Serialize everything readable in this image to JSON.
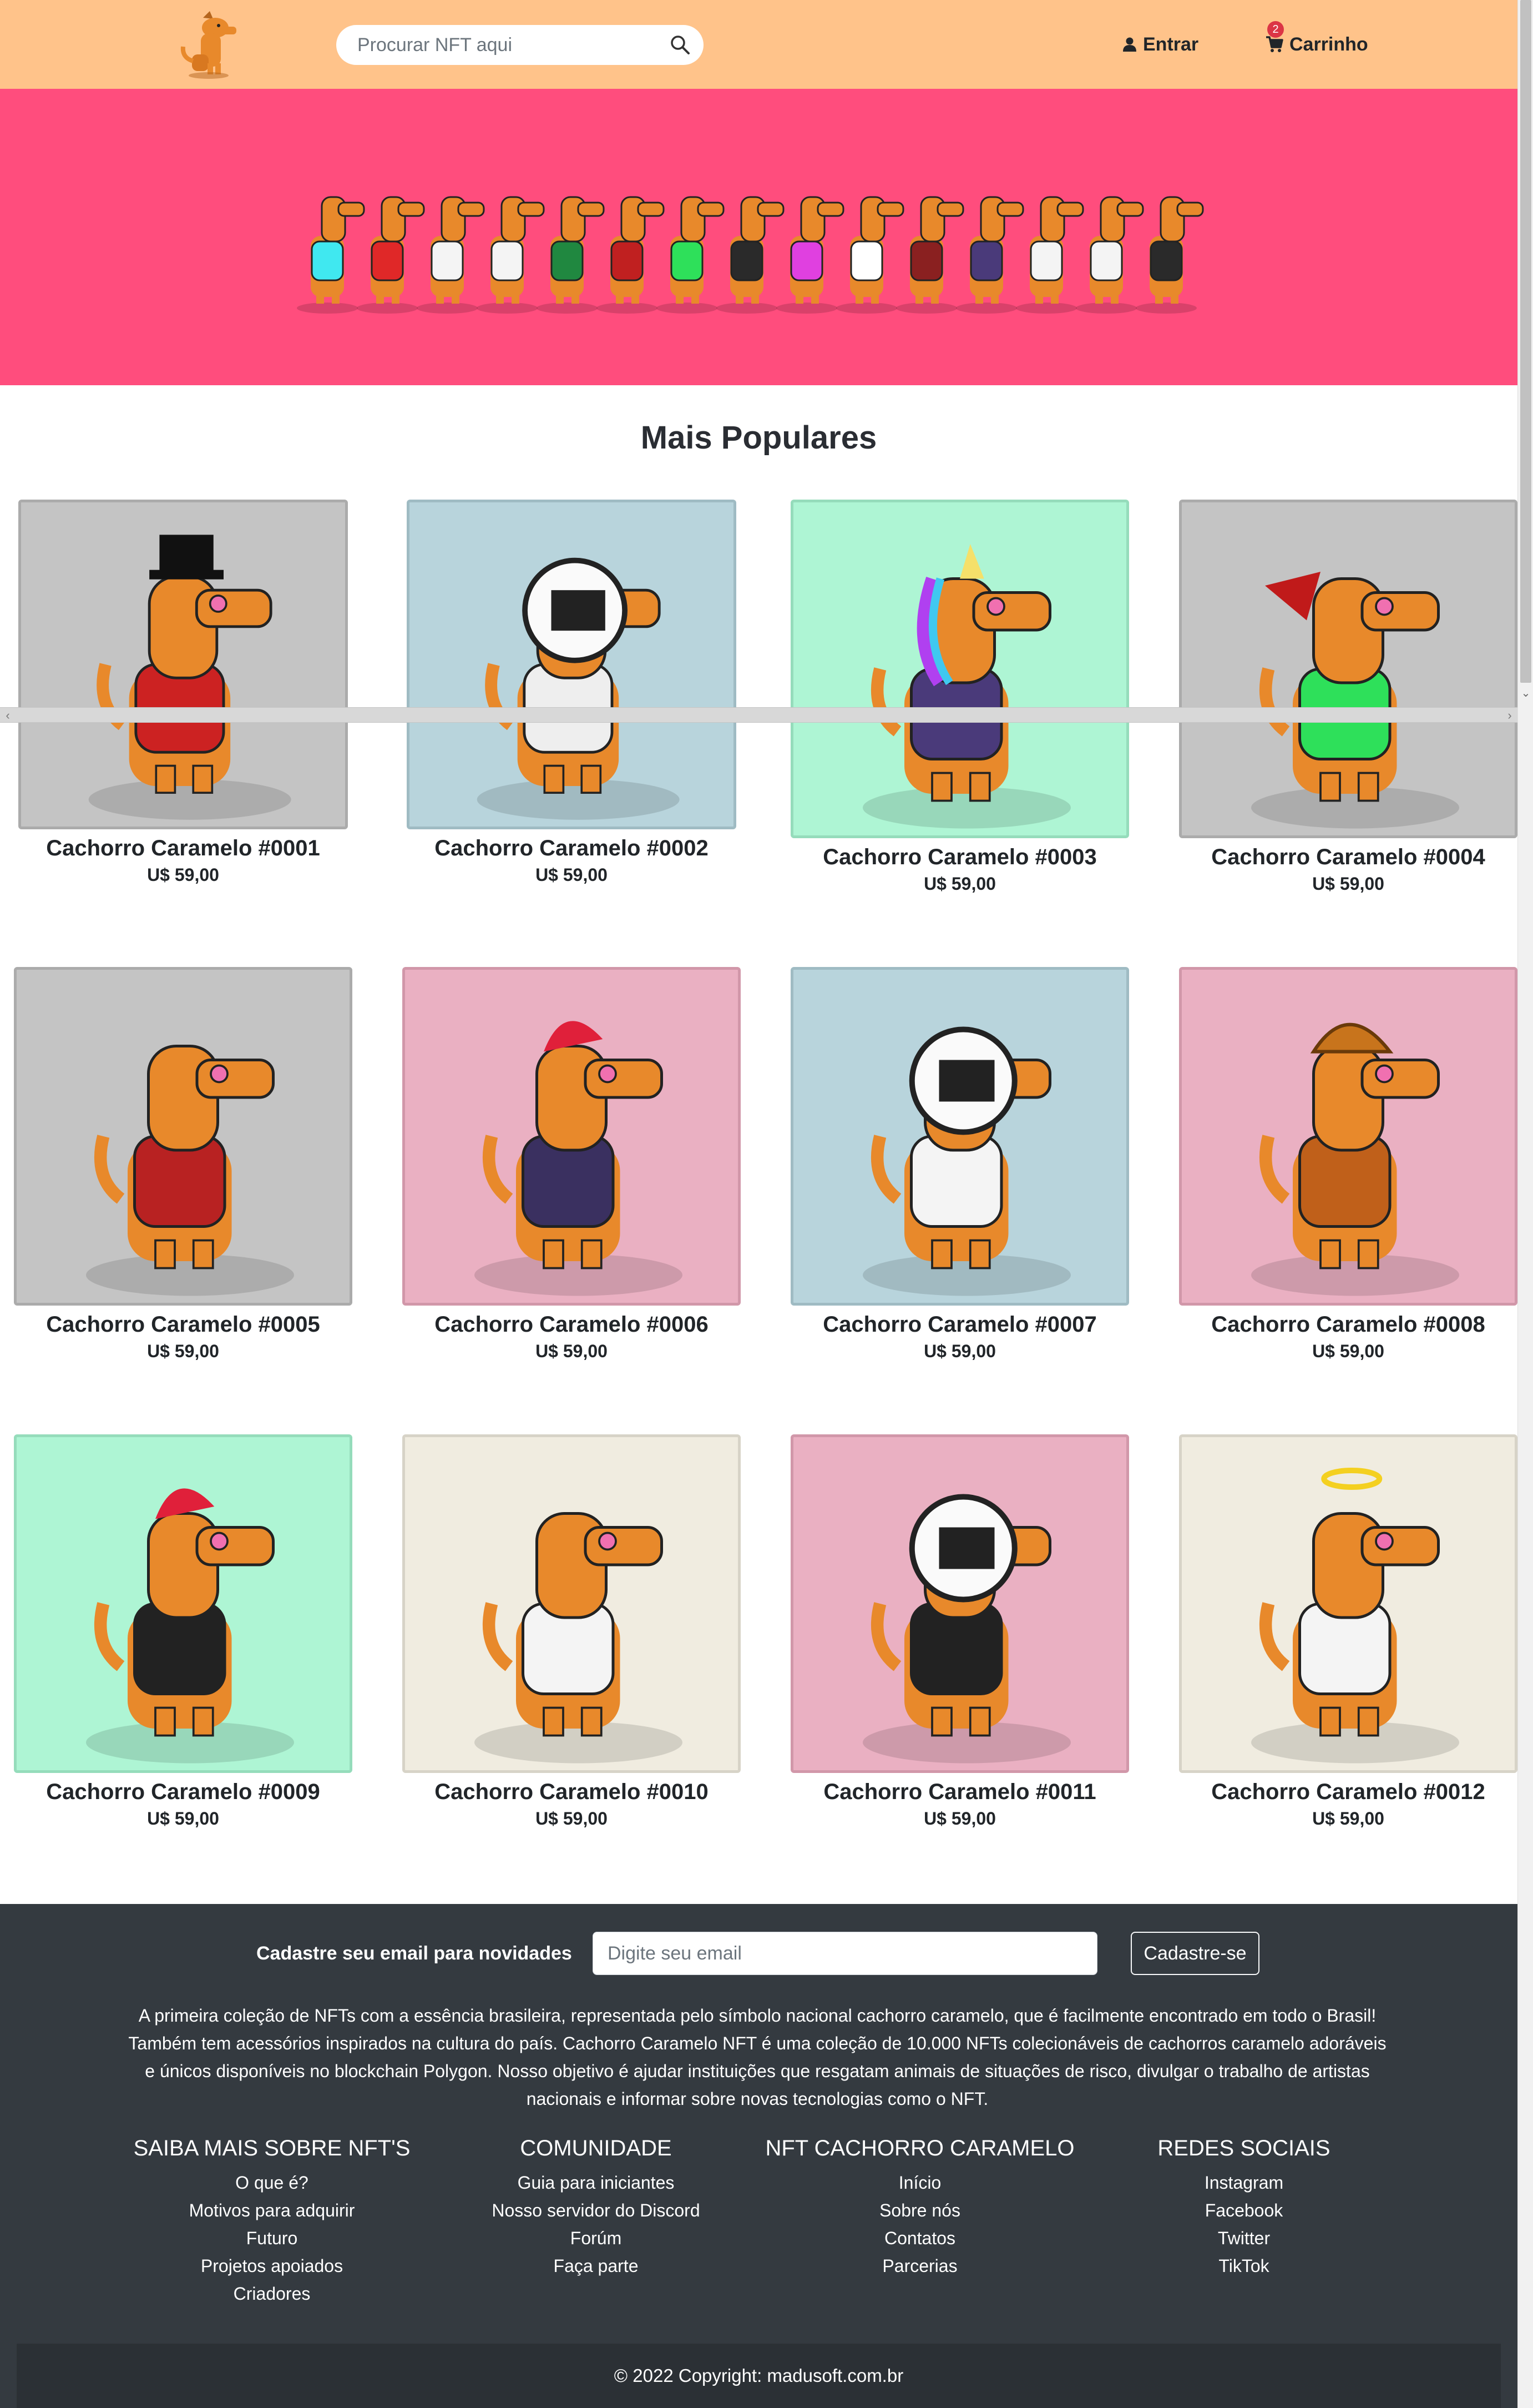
{
  "header": {
    "search_placeholder": "Procurar NFT aqui",
    "login_label": "Entrar",
    "cart_label": "Carrinho",
    "cart_count": "2"
  },
  "main": {
    "title": "Mais Populares",
    "products": [
      {
        "name": "Cachorro Caramelo #0001",
        "price": "U$ 59,00",
        "bg": "#c4c4c4"
      },
      {
        "name": "Cachorro Caramelo #0002",
        "price": "U$ 59,00",
        "bg": "#b8d4dc"
      },
      {
        "name": "Cachorro Caramelo #0003",
        "price": "U$ 59,00",
        "bg": "#aef5d4"
      },
      {
        "name": "Cachorro Caramelo #0004",
        "price": "U$ 59,00",
        "bg": "#c4c4c4"
      },
      {
        "name": "Cachorro Caramelo #0005",
        "price": "U$ 59,00",
        "bg": "#c4c4c4"
      },
      {
        "name": "Cachorro Caramelo #0006",
        "price": "U$ 59,00",
        "bg": "#eab0c2"
      },
      {
        "name": "Cachorro Caramelo #0007",
        "price": "U$ 59,00",
        "bg": "#b8d4dc"
      },
      {
        "name": "Cachorro Caramelo #0008",
        "price": "U$ 59,00",
        "bg": "#eab0c2"
      },
      {
        "name": "Cachorro Caramelo #0009",
        "price": "U$ 59,00",
        "bg": "#aef5d4"
      },
      {
        "name": "Cachorro Caramelo #0010",
        "price": "U$ 59,00",
        "bg": "#f0ece0"
      },
      {
        "name": "Cachorro Caramelo #0011",
        "price": "U$ 59,00",
        "bg": "#eab0c2"
      },
      {
        "name": "Cachorro Caramelo #0012",
        "price": "U$ 59,00",
        "bg": "#f0ece0"
      }
    ]
  },
  "footer": {
    "newsletter_label": "Cadastre seu email para novidades",
    "email_placeholder": "Digite seu email",
    "signup_label": "Cadastre-se",
    "about": "A primeira coleção de NFTs com a essência brasileira, representada pelo símbolo nacional cachorro caramelo, que é facilmente encontrado em todo o Brasil! Também tem acessórios inspirados na cultura do país. Cachorro Caramelo NFT é uma coleção de 10.000 NFTs colecionáveis de cachorros caramelo adoráveis e únicos disponíveis no blockchain Polygon. Nosso objetivo é ajudar instituições que resgatam animais de situações de risco, divulgar o trabalho de artistas nacionais e informar sobre novas tecnologias como o NFT.",
    "columns": [
      {
        "title": "Saiba mais sobre NFT'S",
        "links": [
          "O que é?",
          "Motivos para adquirir",
          "Futuro",
          "Projetos apoiados",
          "Criadores"
        ]
      },
      {
        "title": "Comunidade",
        "links": [
          "Guia para iniciantes",
          "Nosso servidor do Discord",
          "Forúm",
          "Faça parte"
        ]
      },
      {
        "title": "NFT Cachorro Caramelo",
        "links": [
          "Início",
          "Sobre nós",
          "Contatos",
          "Parcerias"
        ]
      },
      {
        "title": "Redes Sociais",
        "links": [
          "Instagram",
          "Facebook",
          "Twitter",
          "TikTok"
        ]
      }
    ],
    "copyright": "© 2022 Copyright: madusoft.com.br"
  },
  "colors": {
    "navbar": "#ffc38a",
    "banner": "#ff4d7d",
    "footer": "#343a40",
    "dog": "#e8892b"
  }
}
